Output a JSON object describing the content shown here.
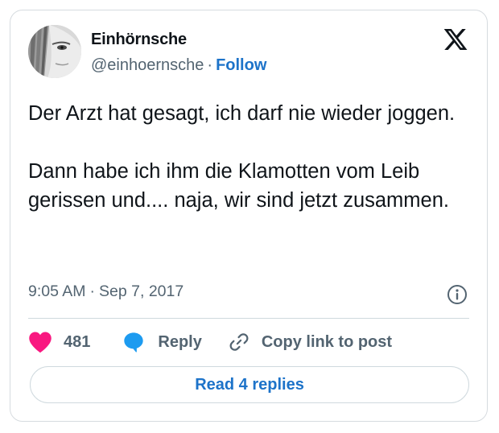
{
  "author": {
    "display_name": "Einhörnsche",
    "handle": "@einhoernsche",
    "separator": "·",
    "follow_label": "Follow",
    "avatar_icon": "avatar-photo-icon"
  },
  "platform": {
    "logo_icon": "x-logo-icon"
  },
  "tweet": {
    "paragraph_1": "Der Arzt hat gesagt, ich darf nie wieder joggen.",
    "paragraph_2": "Dann habe ich ihm die Klamotten vom Leib gerissen und.... naja, wir sind jetzt zusammen."
  },
  "meta": {
    "time": "9:05 AM",
    "separator": "·",
    "date": "Sep 7, 2017",
    "info_icon": "info-icon"
  },
  "actions": {
    "like_count": "481",
    "reply_label": "Reply",
    "copy_label": "Copy link to post"
  },
  "footer": {
    "read_replies_label": "Read 4 replies"
  },
  "colors": {
    "like": "#f91880",
    "reply": "#1d9bf0",
    "link": "#1d73c9",
    "text": "#0f1419",
    "muted": "#536471",
    "border": "#cfd9de"
  }
}
